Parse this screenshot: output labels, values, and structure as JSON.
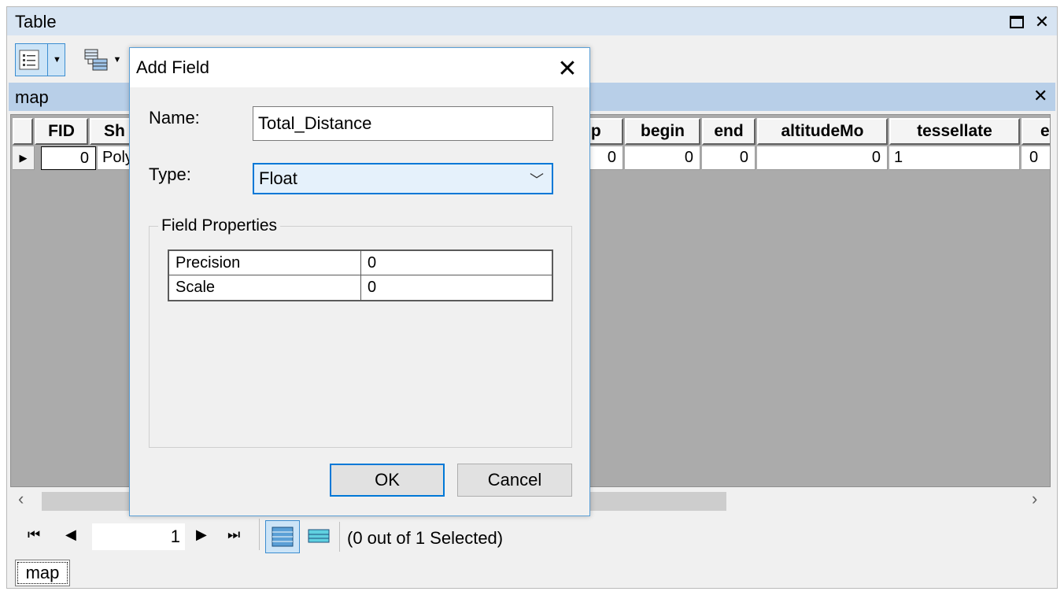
{
  "window": {
    "title": "Table",
    "maximize_icon": "maximize-icon",
    "close_icon": "close-icon"
  },
  "toolbar": {
    "table_options_icon": "table-options-icon",
    "related_tables_icon": "related-tables-icon"
  },
  "table": {
    "name": "map",
    "columns": [
      "FID",
      "Sh",
      "np",
      "begin",
      "end",
      "altitudeMo",
      "tessellate",
      "ex"
    ],
    "row": [
      "0",
      "Poly",
      "0",
      "0",
      "0",
      "0",
      "1",
      "0"
    ]
  },
  "navigation": {
    "current_record": "1",
    "status": "(0 out of 1 Selected)"
  },
  "tab": {
    "label": "map"
  },
  "dialog": {
    "title": "Add Field",
    "name_label": "Name:",
    "name_value": "Total_Distance",
    "type_label": "Type:",
    "type_value": "Float",
    "field_properties_label": "Field Properties",
    "properties": [
      {
        "name": "Precision",
        "value": "0"
      },
      {
        "name": "Scale",
        "value": "0"
      }
    ],
    "ok_label": "OK",
    "cancel_label": "Cancel"
  },
  "colors": {
    "titlebar_bg": "#d7e4f2",
    "map_header_bg": "#b8cfe8",
    "accent": "#0078d7",
    "grid_bg": "#ababab"
  }
}
